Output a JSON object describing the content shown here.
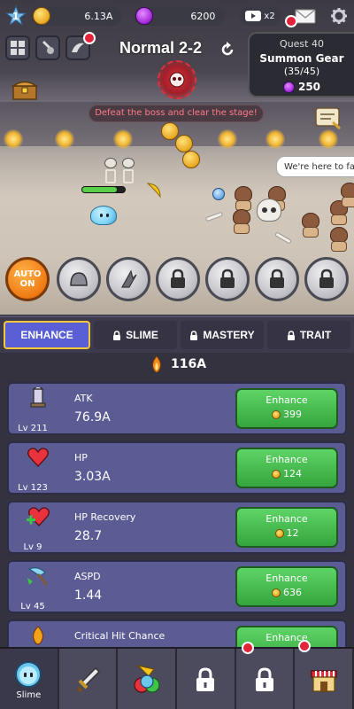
{
  "hud": {
    "level": "1",
    "gold": "6.13A",
    "gems": "6200",
    "video_count": "x2"
  },
  "stage": {
    "title": "Normal 2-2",
    "objective": "Defeat the boss and clear the stage!",
    "speech": "We're here to far"
  },
  "quest": {
    "title": "Quest 40",
    "name": "Summon Gear",
    "progress": "(35/45)",
    "reward": "250"
  },
  "skills": {
    "auto_label_1": "AUTO",
    "auto_label_2": "ON"
  },
  "tabs": [
    {
      "label": "ENHANCE",
      "locked": false
    },
    {
      "label": "SLIME",
      "locked": true
    },
    {
      "label": "MASTERY",
      "locked": true
    },
    {
      "label": "TRAIT",
      "locked": true
    }
  ],
  "power": "116A",
  "stats": [
    {
      "name": "ATK",
      "value": "76.9A",
      "level": "Lv 211",
      "button": "Enhance",
      "cost": "399"
    },
    {
      "name": "HP",
      "value": "3.03A",
      "level": "Lv 123",
      "button": "Enhance",
      "cost": "124"
    },
    {
      "name": "HP Recovery",
      "value": "28.7",
      "level": "Lv 9",
      "button": "Enhance",
      "cost": "12"
    },
    {
      "name": "ASPD",
      "value": "1.44",
      "level": "Lv 45",
      "button": "Enhance",
      "cost": "636"
    },
    {
      "name": "Critical Hit Chance",
      "value": "",
      "level": "",
      "button": "Enhance",
      "cost": ""
    }
  ],
  "bottom_nav": {
    "slime_label": "Slime"
  },
  "colors": {
    "accent": "#5b5fd6",
    "enhance_green": "#4cc254",
    "card": "#5a5c93",
    "alert": "#e2233a"
  }
}
